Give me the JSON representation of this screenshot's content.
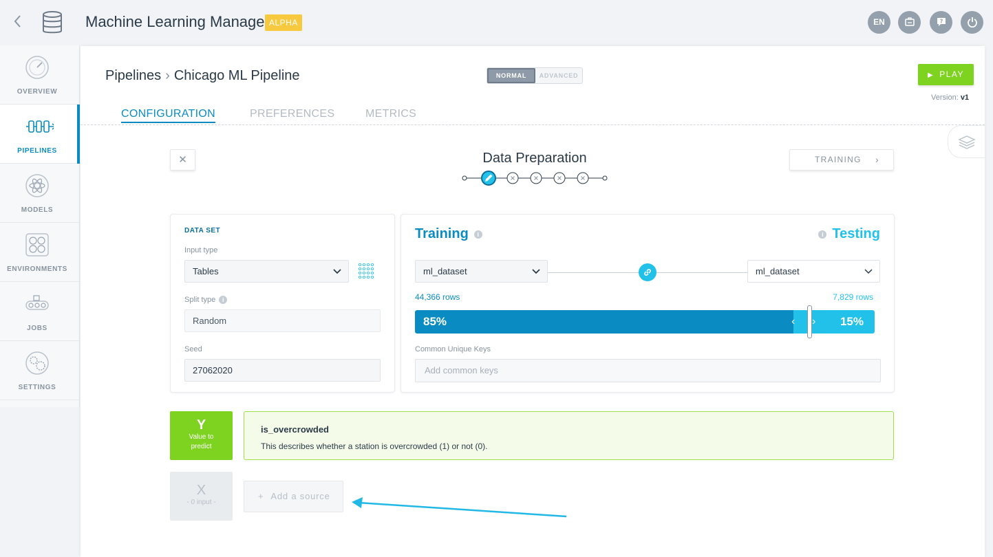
{
  "app": {
    "title": "Machine Learning Manager",
    "badge": "ALPHA",
    "lang_button": "EN"
  },
  "sidebar": {
    "items": [
      {
        "label": "OVERVIEW",
        "icon": "gauge-icon",
        "active": false
      },
      {
        "label": "PIPELINES",
        "icon": "pipeline-icon",
        "active": true
      },
      {
        "label": "MODELS",
        "icon": "atom-icon",
        "active": false
      },
      {
        "label": "ENVIRONMENTS",
        "icon": "cluster-icon",
        "active": false
      },
      {
        "label": "JOBS",
        "icon": "conveyor-icon",
        "active": false
      },
      {
        "label": "SETTINGS",
        "icon": "gears-icon",
        "active": false
      }
    ]
  },
  "header": {
    "breadcrumb_root": "Pipelines",
    "breadcrumb_current": "Chicago ML Pipeline",
    "mode_normal": "NORMAL",
    "mode_advanced": "ADVANCED",
    "play_label": "PLAY",
    "version_label": "Version:",
    "version_value": "v1"
  },
  "tabs": [
    {
      "label": "CONFIGURATION",
      "active": true
    },
    {
      "label": "PREFERENCES",
      "active": false
    },
    {
      "label": "METRICS",
      "active": false
    }
  ],
  "step": {
    "title": "Data Preparation",
    "next_label": "TRAINING",
    "total_steps": 5,
    "current_step": 1
  },
  "dataset": {
    "heading": "DATA SET",
    "input_type_label": "Input type",
    "input_type_value": "Tables",
    "split_type_label": "Split type",
    "split_type_value": "Random",
    "seed_label": "Seed",
    "seed_value": "27062020"
  },
  "split": {
    "training_title": "Training",
    "testing_title": "Testing",
    "training_dataset": "ml_dataset",
    "testing_dataset": "ml_dataset",
    "training_rows": "44,366 rows",
    "testing_rows": "7,829 rows",
    "training_pct": "85%",
    "testing_pct": "15%",
    "training_fraction": 0.85,
    "common_keys_label": "Common Unique Keys",
    "common_keys_placeholder": "Add common keys"
  },
  "target": {
    "y_letter": "Y",
    "y_caption": "Value to predict",
    "name": "is_overcrowded",
    "description": "This describes whether a station is overcrowded (1) or not (0)."
  },
  "inputs": {
    "x_letter": "X",
    "x_caption": "- 0 input -",
    "add_source_label": "Add a source"
  },
  "colors": {
    "training": "#0a8cc3",
    "testing": "#22c1ea",
    "play": "#7ed321",
    "alpha": "#f7c93e"
  }
}
